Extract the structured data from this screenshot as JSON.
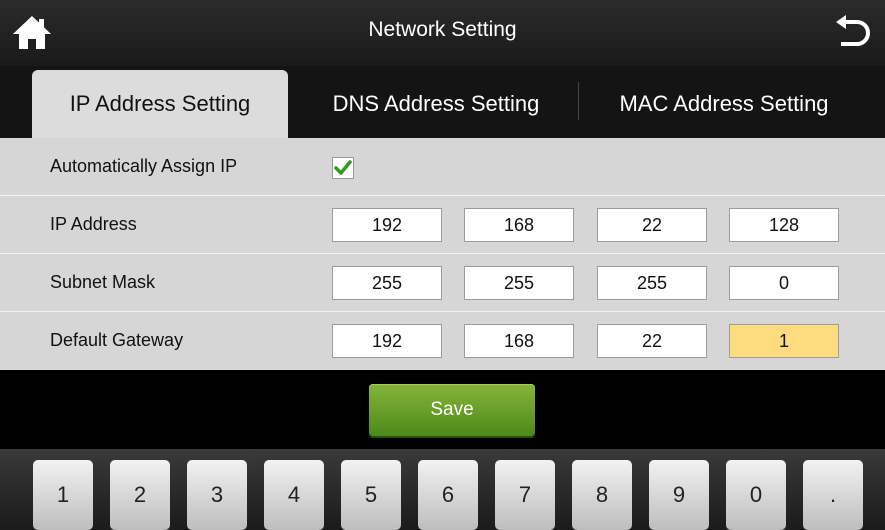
{
  "header": {
    "title": "Network Setting",
    "home_icon": "home-icon",
    "back_icon": "back-arrow-icon"
  },
  "tabs": [
    {
      "label": "IP Address Setting",
      "active": true
    },
    {
      "label": "DNS Address Setting",
      "active": false
    },
    {
      "label": "MAC Address Setting",
      "active": false
    }
  ],
  "form": {
    "auto_assign": {
      "label": "Automatically Assign IP",
      "checked": true
    },
    "ip_address": {
      "label": "IP Address",
      "octets": [
        "192",
        "168",
        "22",
        "128"
      ]
    },
    "subnet_mask": {
      "label": "Subnet Mask",
      "octets": [
        "255",
        "255",
        "255",
        "0"
      ]
    },
    "default_gateway": {
      "label": "Default Gateway",
      "octets": [
        "192",
        "168",
        "22",
        "1"
      ]
    }
  },
  "save_label": "Save",
  "keypad": [
    "1",
    "2",
    "3",
    "4",
    "5",
    "6",
    "7",
    "8",
    "9",
    "0",
    "."
  ],
  "colors": {
    "accent_green": "#5f9a22",
    "focused_field": "#fddb7e",
    "panel_gray": "#d6d6d6",
    "check_green": "#2f9a1e"
  }
}
